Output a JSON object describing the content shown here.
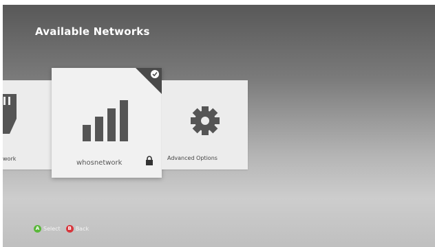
{
  "screen": {
    "title": "Available Networks"
  },
  "tiles": {
    "wired": {
      "label": "work",
      "icon": "ethernet-plug-icon"
    },
    "selected_network": {
      "label": "whosnetwork",
      "icon": "signal-bars-icon",
      "secured": true,
      "selected": true
    },
    "advanced": {
      "label": "Advanced Options",
      "icon": "gear-icon"
    }
  },
  "footer": {
    "a_button": "A",
    "a_label": "Select",
    "b_button": "B",
    "b_label": "Back"
  },
  "colors": {
    "a_button": "#5ab83a",
    "b_button": "#d7363c",
    "tile": "#ececec",
    "icon": "#555555"
  }
}
